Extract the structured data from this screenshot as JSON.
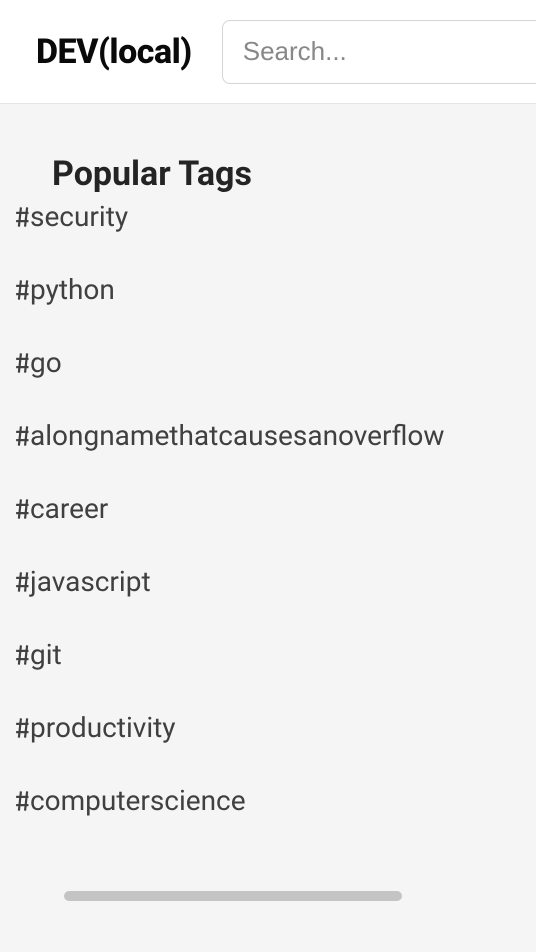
{
  "header": {
    "logo": "DEV(local)",
    "search_placeholder": "Search..."
  },
  "sidebar": {
    "section_title": "Popular Tags",
    "tags": [
      "security",
      "python",
      "go",
      "alongnamethatcausesanoverflow",
      "career",
      "javascript",
      "git",
      "productivity",
      "computerscience"
    ]
  }
}
